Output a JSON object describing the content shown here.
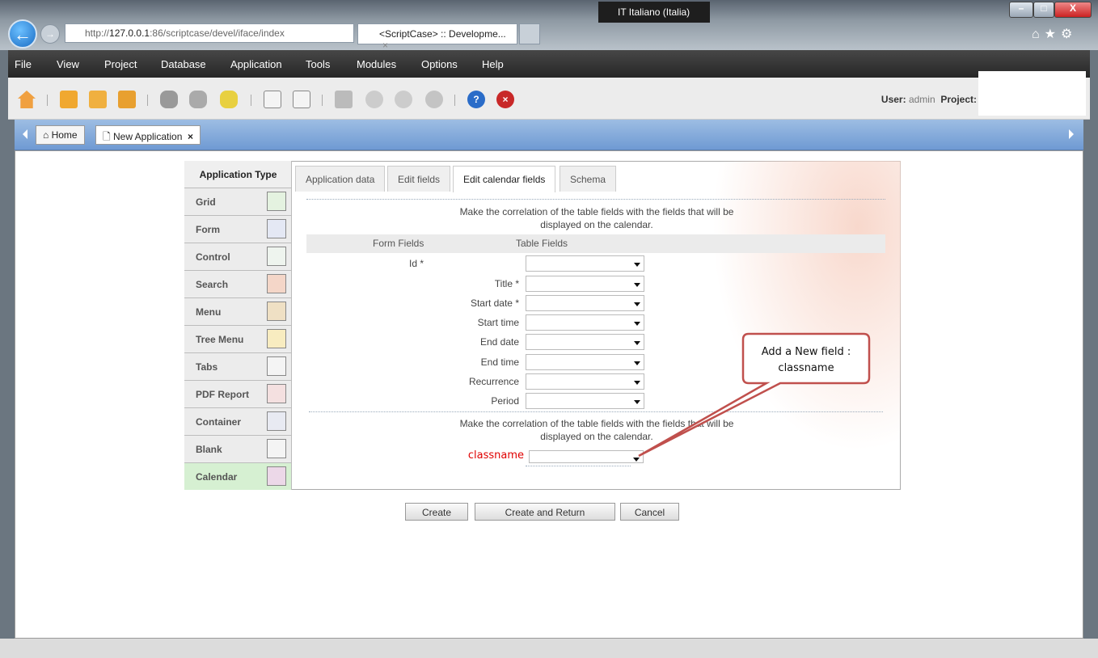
{
  "browser": {
    "url_prefix": "http://",
    "url_host": "127.0.0.1",
    "url_rest": ":86/scriptcase/devel/iface/index",
    "tab_title": "<ScriptCase> :: Developme...",
    "tab_close": "×",
    "language": "IT Italiano (Italia)",
    "window_min": "–",
    "window_max": "□",
    "window_close": "X",
    "icons": "⌂★⚙"
  },
  "menu": [
    "File",
    "View",
    "Project",
    "Database",
    "Application",
    "Tools",
    "Modules",
    "Options",
    "Help"
  ],
  "toolbar": {
    "user_label": "User:",
    "user_value": "admin",
    "project_label": "Project:"
  },
  "apptabs": {
    "home": "Home",
    "new_app": "New Application",
    "close": "×"
  },
  "sidebar": {
    "title": "Application Type",
    "items": [
      "Grid",
      "Form",
      "Control",
      "Search",
      "Menu",
      "Tree Menu",
      "Tabs",
      "PDF Report",
      "Container",
      "Blank",
      "Calendar"
    ],
    "active": "Calendar"
  },
  "tabs": [
    "Application data",
    "Edit fields",
    "Edit calendar fields",
    "Schema"
  ],
  "active_tab": "Edit calendar fields",
  "form": {
    "intro": "Make the correlation of the table fields with the fields that will be displayed on the calendar.",
    "col_form": "Form Fields",
    "col_table": "Table Fields",
    "fields": [
      "Id *",
      "Title *",
      "Start date *",
      "Start time",
      "End date",
      "End time",
      "Recurrence",
      "Period"
    ],
    "intro2": "Make the correlation of the table fields with the fields that will be displayed on the calendar.",
    "extra_field": "classname"
  },
  "buttons": {
    "create": "Create",
    "create_return": "Create and Return",
    "cancel": "Cancel"
  },
  "callout": {
    "line1": "Add a New field :",
    "line2": "classname"
  },
  "colors": {
    "menubar": "#2e2e2e",
    "tabbar": "#7fa6d8",
    "accent_red": "#e00000",
    "callout_border": "#c0504d"
  }
}
